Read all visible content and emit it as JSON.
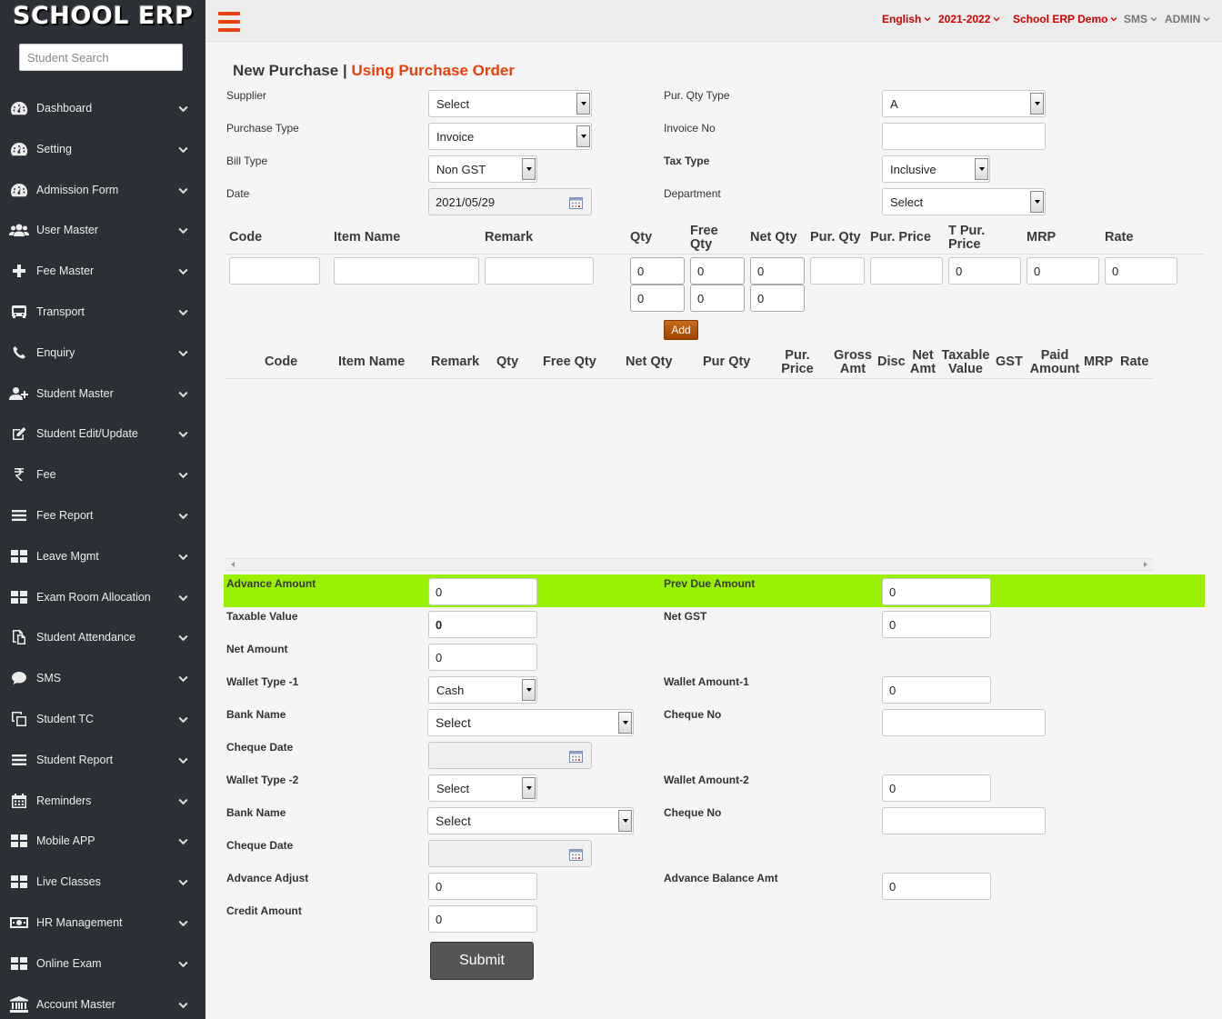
{
  "app": {
    "logo": "SCHOOL ERP"
  },
  "sidebar": {
    "search_placeholder": "Student Search",
    "items": [
      {
        "label": "Dashboard",
        "icon": "dashboard-icon"
      },
      {
        "label": "Setting",
        "icon": "dashboard-icon"
      },
      {
        "label": "Admission Form",
        "icon": "dashboard-icon"
      },
      {
        "label": "User Master",
        "icon": "users-icon"
      },
      {
        "label": "Fee Master",
        "icon": "plus-icon"
      },
      {
        "label": "Transport",
        "icon": "bus-icon"
      },
      {
        "label": "Enquiry",
        "icon": "phone-icon"
      },
      {
        "label": "Student Master",
        "icon": "user-plus-icon"
      },
      {
        "label": "Student Edit/Update",
        "icon": "edit-icon"
      },
      {
        "label": "Fee",
        "icon": "rupee-icon"
      },
      {
        "label": "Fee Report",
        "icon": "list-icon"
      },
      {
        "label": "Leave Mgmt",
        "icon": "grid-icon"
      },
      {
        "label": "Exam Room Allocation",
        "icon": "grid-icon"
      },
      {
        "label": "Student Attendance",
        "icon": "copy-icon"
      },
      {
        "label": "SMS",
        "icon": "comment-icon"
      },
      {
        "label": "Student TC",
        "icon": "clone-icon"
      },
      {
        "label": "Student Report",
        "icon": "list-icon"
      },
      {
        "label": "Reminders",
        "icon": "calendar-icon"
      },
      {
        "label": "Mobile APP",
        "icon": "grid-icon"
      },
      {
        "label": "Live Classes",
        "icon": "grid-icon"
      },
      {
        "label": "HR Management",
        "icon": "money-icon"
      },
      {
        "label": "Online Exam",
        "icon": "grid-icon"
      },
      {
        "label": "Account Master",
        "icon": "bank-icon"
      }
    ]
  },
  "topbar": {
    "language": "English",
    "session": "2021-2022",
    "school": "School ERP Demo",
    "sms": "SMS",
    "user": "ADMIN"
  },
  "page": {
    "title": "New Purchase",
    "separator": "|",
    "subtitle": "Using Purchase Order"
  },
  "form": {
    "supplier": {
      "label": "Supplier",
      "value": "Select"
    },
    "purchase_type": {
      "label": "Purchase Type",
      "value": "Invoice"
    },
    "bill_type": {
      "label": "Bill Type",
      "value": "Non GST"
    },
    "date": {
      "label": "Date",
      "value": "2021/05/29"
    },
    "pur_qty_type": {
      "label": "Pur. Qty Type",
      "value": "A"
    },
    "invoice_no": {
      "label": "Invoice No",
      "value": ""
    },
    "tax_type": {
      "label": "Tax Type",
      "value": "Inclusive"
    },
    "department": {
      "label": "Department",
      "value": "Select"
    }
  },
  "entry_table": {
    "headers": {
      "code": "Code",
      "item_name": "Item Name",
      "remark": "Remark",
      "qty": "Qty",
      "free_qty": "Free Qty",
      "net_qty": "Net Qty",
      "pur_qty": "Pur. Qty",
      "pur_price": "Pur. Price",
      "t_pur_price": "T Pur. Price",
      "mrp": "MRP",
      "rate": "Rate"
    },
    "row1": {
      "code": "",
      "item_name": "",
      "remark": "",
      "qty": "0",
      "free_qty": "0",
      "net_qty": "0",
      "pur_qty": "",
      "pur_price": "",
      "t_pur_price": "0",
      "mrp": "0",
      "rate": "0"
    },
    "row2": {
      "qty": "0",
      "free_qty": "0",
      "net_qty": "0"
    },
    "add_label": "Add"
  },
  "items_table": {
    "headers": {
      "code": "Code",
      "item_name": "Item Name",
      "remark": "Remark",
      "qty": "Qty",
      "free_qty": "Free Qty",
      "net_qty": "Net Qty",
      "pur_qty": "Pur Qty",
      "pur_price": "Pur. Price",
      "gross_amt": "Gross Amt",
      "disc": "Disc",
      "net_amt": "Net Amt",
      "taxable_value": "Taxable Value",
      "gst": "GST",
      "paid_amount": "Paid Amount",
      "mrp": "MRP",
      "rate": "Rate"
    }
  },
  "summary": {
    "advance_amount": {
      "label": "Advance Amount",
      "value": "0"
    },
    "prev_due_amount": {
      "label": "Prev Due Amount",
      "value": "0"
    },
    "taxable_value": {
      "label": "Taxable Value",
      "value": "0"
    },
    "net_gst": {
      "label": "Net GST",
      "value": "0"
    },
    "net_amount": {
      "label": "Net Amount",
      "value": "0"
    },
    "wallet_type_1": {
      "label": "Wallet Type -1",
      "value": "Cash"
    },
    "wallet_amount_1": {
      "label": "Wallet Amount-1",
      "value": "0"
    },
    "bank_name_1": {
      "label": "Bank Name",
      "value": "Select"
    },
    "cheque_no_1": {
      "label": "Cheque No",
      "value": ""
    },
    "cheque_date_1": {
      "label": "Cheque Date",
      "value": ""
    },
    "wallet_type_2": {
      "label": "Wallet Type -2",
      "value": "Select"
    },
    "wallet_amount_2": {
      "label": "Wallet Amount-2",
      "value": "0"
    },
    "bank_name_2": {
      "label": "Bank Name",
      "value": "Select"
    },
    "cheque_no_2": {
      "label": "Cheque No",
      "value": ""
    },
    "cheque_date_2": {
      "label": "Cheque Date",
      "value": ""
    },
    "advance_adjust": {
      "label": "Advance Adjust",
      "value": "0"
    },
    "advance_balance_amt": {
      "label": "Advance Balance Amt",
      "value": "0"
    },
    "credit_amount": {
      "label": "Credit Amount",
      "value": "0"
    },
    "submit_label": "Submit"
  },
  "colors": {
    "sidebar_bg": "#2b2f36",
    "accent": "#e8400c",
    "topnav_red": "#d00000",
    "highlight_green": "#99f000",
    "submit_bg": "#555555"
  }
}
